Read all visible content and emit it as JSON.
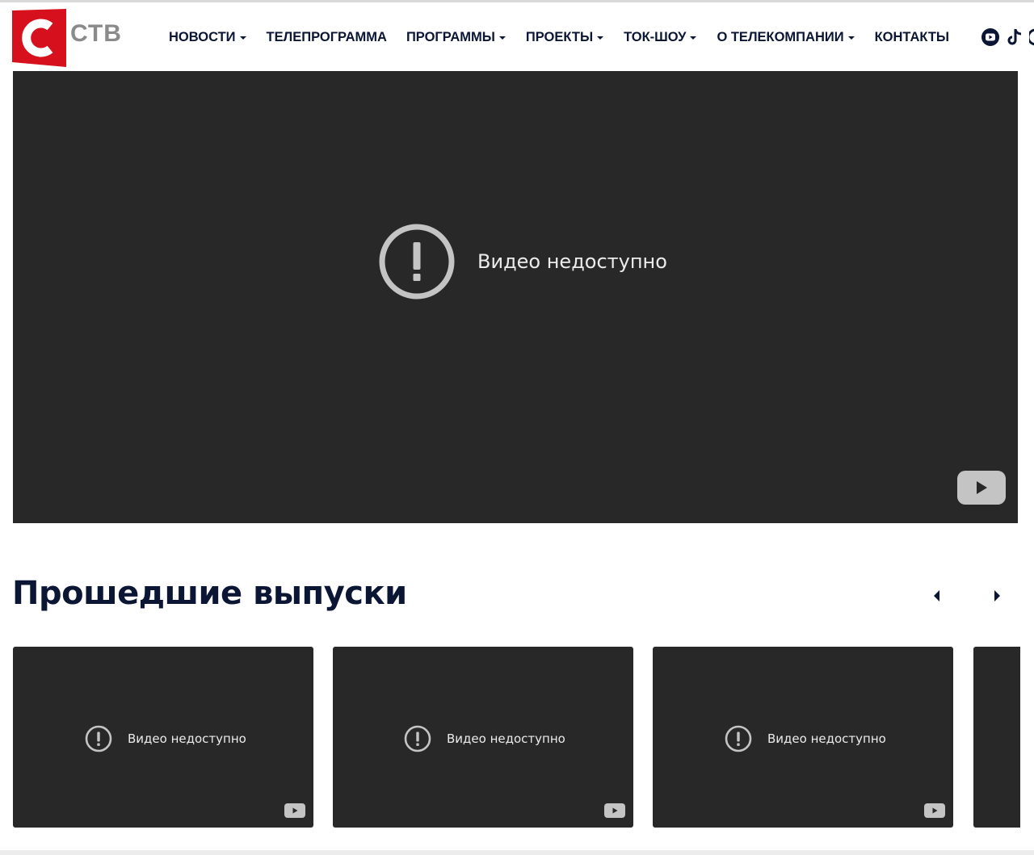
{
  "brand": {
    "logo_text": "СТВ",
    "logo_letter": "С",
    "accent": "#d6101c",
    "logo_gray": "#8a8a8a"
  },
  "nav": [
    {
      "label": "НОВОСТИ",
      "dropdown": true
    },
    {
      "label": "ТЕЛЕПРОГРАММА",
      "dropdown": false
    },
    {
      "label": "ПРОГРАММЫ",
      "dropdown": true
    },
    {
      "label": "ПРОЕКТЫ",
      "dropdown": true
    },
    {
      "label": "ТОК-ШОУ",
      "dropdown": true
    },
    {
      "label": "О ТЕЛЕКОМПАНИИ",
      "dropdown": true
    },
    {
      "label": "КОНТАКТЫ",
      "dropdown": false
    }
  ],
  "social_icons": [
    "youtube-icon",
    "tiktok-icon"
  ],
  "main_video": {
    "message": "Видео недоступно",
    "icon": "error-icon",
    "player_logo": "youtube-play-icon"
  },
  "past_episodes": {
    "title": "Прошедшие выпуски",
    "prev_icon": "arrow-left-icon",
    "next_icon": "arrow-right-icon",
    "items": [
      {
        "message": "Видео недоступно"
      },
      {
        "message": "Видео недоступно"
      },
      {
        "message": "Видео недоступно"
      }
    ]
  },
  "colors": {
    "navy": "#0b1534",
    "video_bg": "#282828",
    "icon_gray": "#c4c4c4"
  }
}
